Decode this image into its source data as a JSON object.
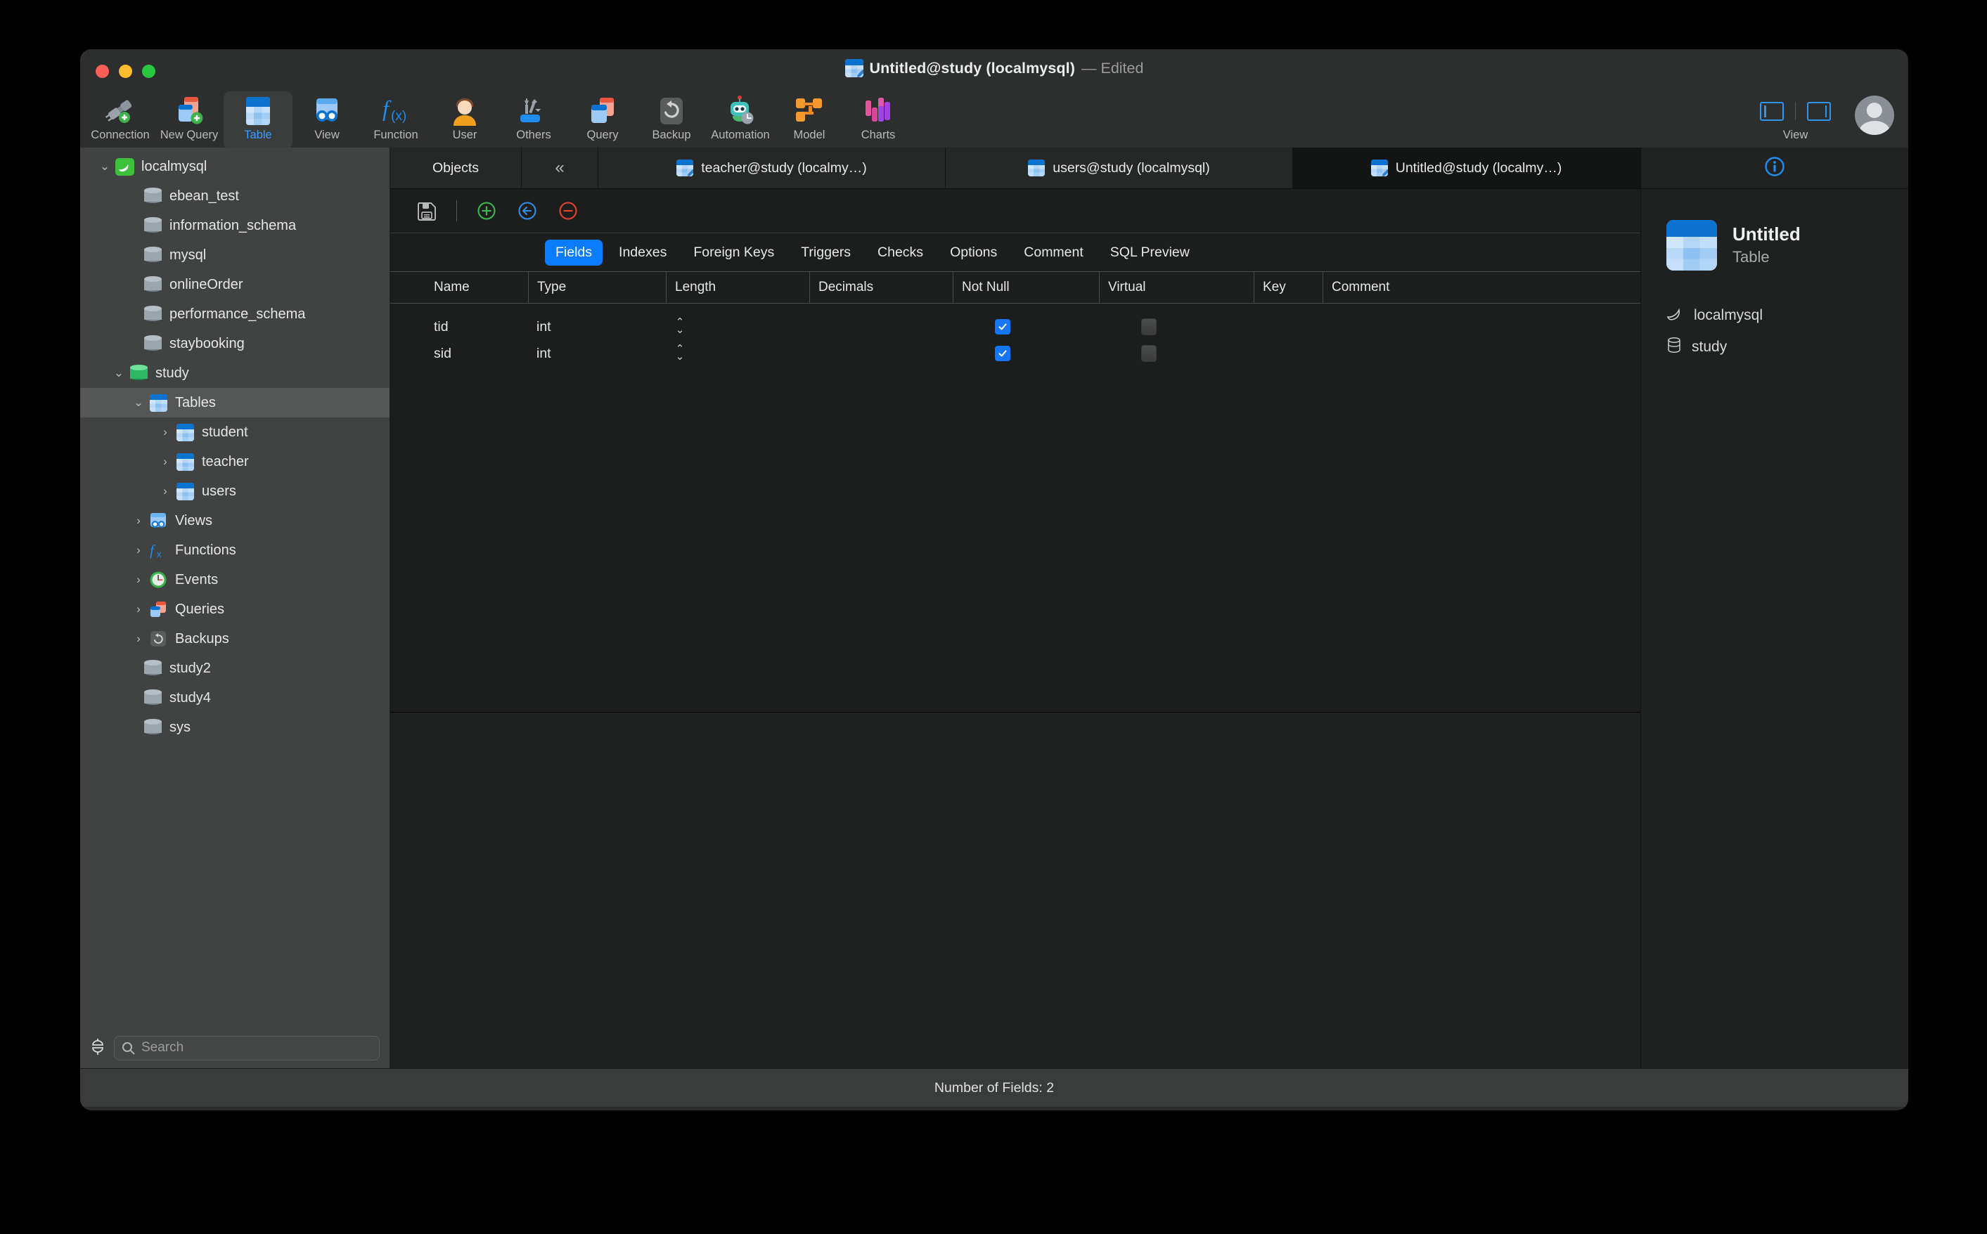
{
  "window": {
    "title": "Untitled@study (localmysql)",
    "edited_suffix": "— Edited",
    "title_icon": "table-document-icon"
  },
  "toolbar": {
    "items": [
      {
        "label": "Connection",
        "icon": "connection-plug-icon",
        "selected": false,
        "has_chevron": true
      },
      {
        "label": "New Query",
        "icon": "new-query-icon",
        "selected": false,
        "has_chevron": false
      },
      {
        "label": "Table",
        "icon": "table-icon",
        "selected": true,
        "has_chevron": false
      },
      {
        "label": "View",
        "icon": "view-icon",
        "selected": false,
        "has_chevron": false
      },
      {
        "label": "Function",
        "icon": "function-fx-icon",
        "selected": false,
        "has_chevron": false
      },
      {
        "label": "User",
        "icon": "user-icon",
        "selected": false,
        "has_chevron": false
      },
      {
        "label": "Others",
        "icon": "others-tools-icon",
        "selected": false,
        "has_chevron": true
      },
      {
        "label": "Query",
        "icon": "query-icon",
        "selected": false,
        "has_chevron": false
      },
      {
        "label": "Backup",
        "icon": "backup-restore-icon",
        "selected": false,
        "has_chevron": false
      },
      {
        "label": "Automation",
        "icon": "automation-robot-icon",
        "selected": false,
        "has_chevron": false
      },
      {
        "label": "Model",
        "icon": "model-nodes-icon",
        "selected": false,
        "has_chevron": false
      },
      {
        "label": "Charts",
        "icon": "charts-bars-icon",
        "selected": false,
        "has_chevron": false
      }
    ],
    "view_group_label": "View",
    "left_pane_icon": "toggle-left-pane-icon",
    "right_pane_icon": "toggle-right-pane-icon",
    "avatar_icon": "user-avatar-icon"
  },
  "sidebar": {
    "tree": [
      {
        "label": "localmysql",
        "indent": 0,
        "icon": "mysql-dolphin-icon",
        "twisty": "down",
        "selected": false
      },
      {
        "label": "ebean_test",
        "indent": 1,
        "icon": "database-icon",
        "twisty": "none",
        "selected": false
      },
      {
        "label": "information_schema",
        "indent": 1,
        "icon": "database-icon",
        "twisty": "none",
        "selected": false
      },
      {
        "label": "mysql",
        "indent": 1,
        "icon": "database-icon",
        "twisty": "none",
        "selected": false
      },
      {
        "label": "onlineOrder",
        "indent": 1,
        "icon": "database-icon",
        "twisty": "none",
        "selected": false
      },
      {
        "label": "performance_schema",
        "indent": 1,
        "icon": "database-icon",
        "twisty": "none",
        "selected": false
      },
      {
        "label": "staybooking",
        "indent": 1,
        "icon": "database-icon",
        "twisty": "none",
        "selected": false
      },
      {
        "label": "study",
        "indent": 1,
        "icon": "database-open-icon",
        "twisty": "down",
        "selected": false
      },
      {
        "label": "Tables",
        "indent": 2,
        "icon": "tables-folder-icon",
        "twisty": "down",
        "selected": true
      },
      {
        "label": "student",
        "indent": 3,
        "icon": "table-icon",
        "twisty": "right",
        "selected": false
      },
      {
        "label": "teacher",
        "indent": 3,
        "icon": "table-icon",
        "twisty": "right",
        "selected": false
      },
      {
        "label": "users",
        "indent": 3,
        "icon": "table-icon",
        "twisty": "right",
        "selected": false
      },
      {
        "label": "Views",
        "indent": 2,
        "icon": "views-icon",
        "twisty": "right",
        "selected": false
      },
      {
        "label": "Functions",
        "indent": 2,
        "icon": "functions-fx-icon",
        "twisty": "right",
        "selected": false
      },
      {
        "label": "Events",
        "indent": 2,
        "icon": "events-clock-icon",
        "twisty": "right",
        "selected": false
      },
      {
        "label": "Queries",
        "indent": 2,
        "icon": "queries-icon",
        "twisty": "right",
        "selected": false
      },
      {
        "label": "Backups",
        "indent": 2,
        "icon": "backups-icon",
        "twisty": "right",
        "selected": false
      },
      {
        "label": "study2",
        "indent": 1,
        "icon": "database-icon",
        "twisty": "none",
        "selected": false
      },
      {
        "label": "study4",
        "indent": 1,
        "icon": "database-icon",
        "twisty": "none",
        "selected": false
      },
      {
        "label": "sys",
        "indent": 1,
        "icon": "database-icon",
        "twisty": "none",
        "selected": false
      }
    ],
    "search_placeholder": "Search",
    "connection_status_icon": "plug-icon"
  },
  "tabs": {
    "objects_label": "Objects",
    "collapse_icon": "chevron-double-left-icon",
    "documents": [
      {
        "label": "teacher@study (localmy…)",
        "icon": "table-document-icon",
        "active": false
      },
      {
        "label": "users@study (localmysql)",
        "icon": "table-icon",
        "active": false
      },
      {
        "label": "Untitled@study (localmy…)",
        "icon": "table-document-icon",
        "active": true
      }
    ]
  },
  "editor_toolbar": {
    "save_icon": "floppy-save-icon",
    "add_field_icon": "add-field-plus-icon",
    "insert_field_icon": "insert-field-arrow-icon",
    "delete_field_icon": "delete-field-minus-icon"
  },
  "subtabs": [
    {
      "label": "Fields",
      "active": true
    },
    {
      "label": "Indexes",
      "active": false
    },
    {
      "label": "Foreign Keys",
      "active": false
    },
    {
      "label": "Triggers",
      "active": false
    },
    {
      "label": "Checks",
      "active": false
    },
    {
      "label": "Options",
      "active": false
    },
    {
      "label": "Comment",
      "active": false
    },
    {
      "label": "SQL Preview",
      "active": false
    }
  ],
  "fields_grid": {
    "columns": [
      "Name",
      "Type",
      "Length",
      "Decimals",
      "Not Null",
      "Virtual",
      "Key",
      "Comment"
    ],
    "rows": [
      {
        "name": "tid",
        "type": "int",
        "length": "",
        "decimals": "",
        "not_null": true,
        "virtual": false,
        "key": "",
        "comment": ""
      },
      {
        "name": "sid",
        "type": "int",
        "length": "",
        "decimals": "",
        "not_null": true,
        "virtual": false,
        "key": "",
        "comment": ""
      }
    ]
  },
  "inspector": {
    "header_icon": "info-circle-icon",
    "object_icon": "table-icon",
    "name": "Untitled",
    "type": "Table",
    "meta": [
      {
        "label": "localmysql",
        "icon": "mysql-dolphin-outline-icon"
      },
      {
        "label": "study",
        "icon": "database-outline-icon"
      }
    ]
  },
  "status_bar": {
    "text": "Number of Fields: 2"
  },
  "colors": {
    "accent": "#0a7cff",
    "checkbox": "#1576f6",
    "selected_toolbar_label": "#3b9dff",
    "sidebar_bg": "#414242",
    "main_bg": "#1c1d1d"
  }
}
